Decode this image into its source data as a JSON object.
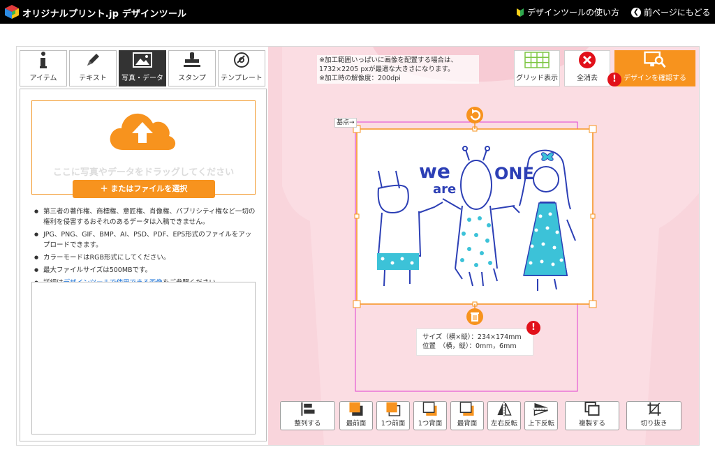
{
  "header": {
    "brand": "オリジナルプリント.jp デザインツール",
    "help_link": "デザインツールの使い方",
    "back_link": "前ページにもどる"
  },
  "tabs": [
    {
      "label": "アイテム",
      "icon": "info-icon"
    },
    {
      "label": "テキスト",
      "icon": "pen-icon"
    },
    {
      "label": "写真・データ",
      "icon": "image-icon",
      "active": true
    },
    {
      "label": "スタンプ",
      "icon": "stamp-icon"
    },
    {
      "label": "テンプレート",
      "icon": "template-icon"
    }
  ],
  "upload": {
    "drop_text": "ここに写真やデータをドラッグしてください",
    "file_button": "＋ またはファイルを選択"
  },
  "notes": [
    "第三者の著作権、商標権、意匠権、肖像権、パブリシティ権など一切の権利を侵害するおそれのあるデータは入稿できません。",
    "JPG、PNG、GIF、BMP、AI、PSD、PDF、EPS形式のファイルをアップロードできます。",
    "カラーモードはRGB形式にしてください。",
    "最大ファイルサイズは500MBです。"
  ],
  "note_link": {
    "prefix": "詳細は",
    "link": "デザインツールで使用できる画像",
    "suffix": "をご参照ください。"
  },
  "hint": {
    "line1": "※加工範囲いっぱいに画像を配置する場合は、",
    "line2": "1732×2205 pxが最適な大きさになります。",
    "line3": "※加工時の解像度：200dpi"
  },
  "toolbar": {
    "grid": "グリッド表示",
    "clear": "全消去",
    "confirm": "デザインを確認する"
  },
  "canvas": {
    "base_label": "基点→",
    "size_line": "サイズ（横×縦）：234×174mm",
    "position_line": "位置　（横，縦）：0mm，6mm"
  },
  "artwork": {
    "word1": "we",
    "word2": "are",
    "word3": "ONE"
  },
  "bottom_toolbar": [
    {
      "label": "整列する",
      "icon": "align-icon"
    },
    {
      "label": "最前面",
      "icon": "bring-to-front-icon"
    },
    {
      "label": "1つ前面",
      "icon": "bring-forward-icon"
    },
    {
      "label": "1つ背面",
      "icon": "send-backward-icon"
    },
    {
      "label": "最背面",
      "icon": "send-to-back-icon"
    },
    {
      "label": "左右反転",
      "icon": "flip-horizontal-icon"
    },
    {
      "label": "上下反転",
      "icon": "flip-vertical-icon"
    },
    {
      "label": "複製する",
      "icon": "duplicate-icon"
    },
    {
      "label": "切り抜き",
      "icon": "crop-icon"
    }
  ],
  "colors": {
    "accent": "#f7931e",
    "shirt": "#fbe0e5",
    "warning": "#e1111a",
    "guide": "#e040d0"
  }
}
